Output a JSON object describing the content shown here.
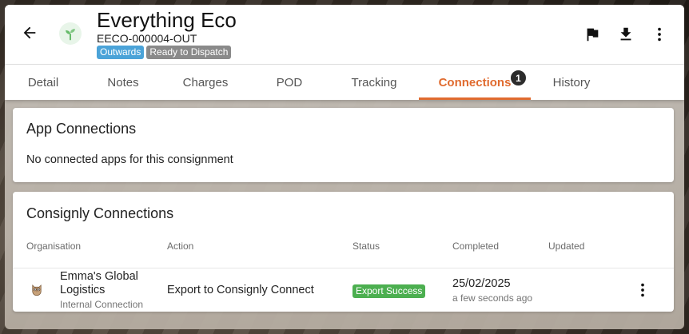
{
  "header": {
    "title": "Everything Eco",
    "reference": "EECO-000004-OUT",
    "badges": [
      "Outwards",
      "Ready to Dispatch"
    ],
    "icons": {
      "back": "arrow-left-icon",
      "logo": "sprout-icon",
      "flag": "flag-icon",
      "download": "download-icon",
      "menu": "more-vertical-icon"
    }
  },
  "tabs": [
    {
      "label": "Detail"
    },
    {
      "label": "Notes"
    },
    {
      "label": "Charges"
    },
    {
      "label": "POD"
    },
    {
      "label": "Tracking"
    },
    {
      "label": "Connections",
      "active": true,
      "count": "1"
    },
    {
      "label": "History"
    }
  ],
  "app_connections": {
    "title": "App Connections",
    "empty_message": "No connected apps for this consignment"
  },
  "consignly_connections": {
    "title": "Consignly Connections",
    "columns": [
      "Organisation",
      "Action",
      "Status",
      "Completed",
      "Updated"
    ],
    "rows": [
      {
        "organisation": "Emma's Global Logistics",
        "organisation_sub": "Internal Connection",
        "organisation_icon": "owl-icon",
        "action": "Export to Consignly Connect",
        "status": "Export Success",
        "completed_date": "25/02/2025",
        "completed_relative": "a few seconds ago",
        "updated": ""
      }
    ]
  },
  "colors": {
    "accent": "#e06b2f",
    "badge_outwards": "#4ba3d8",
    "badge_status": "#8a8a8a",
    "success": "#4caf50"
  }
}
